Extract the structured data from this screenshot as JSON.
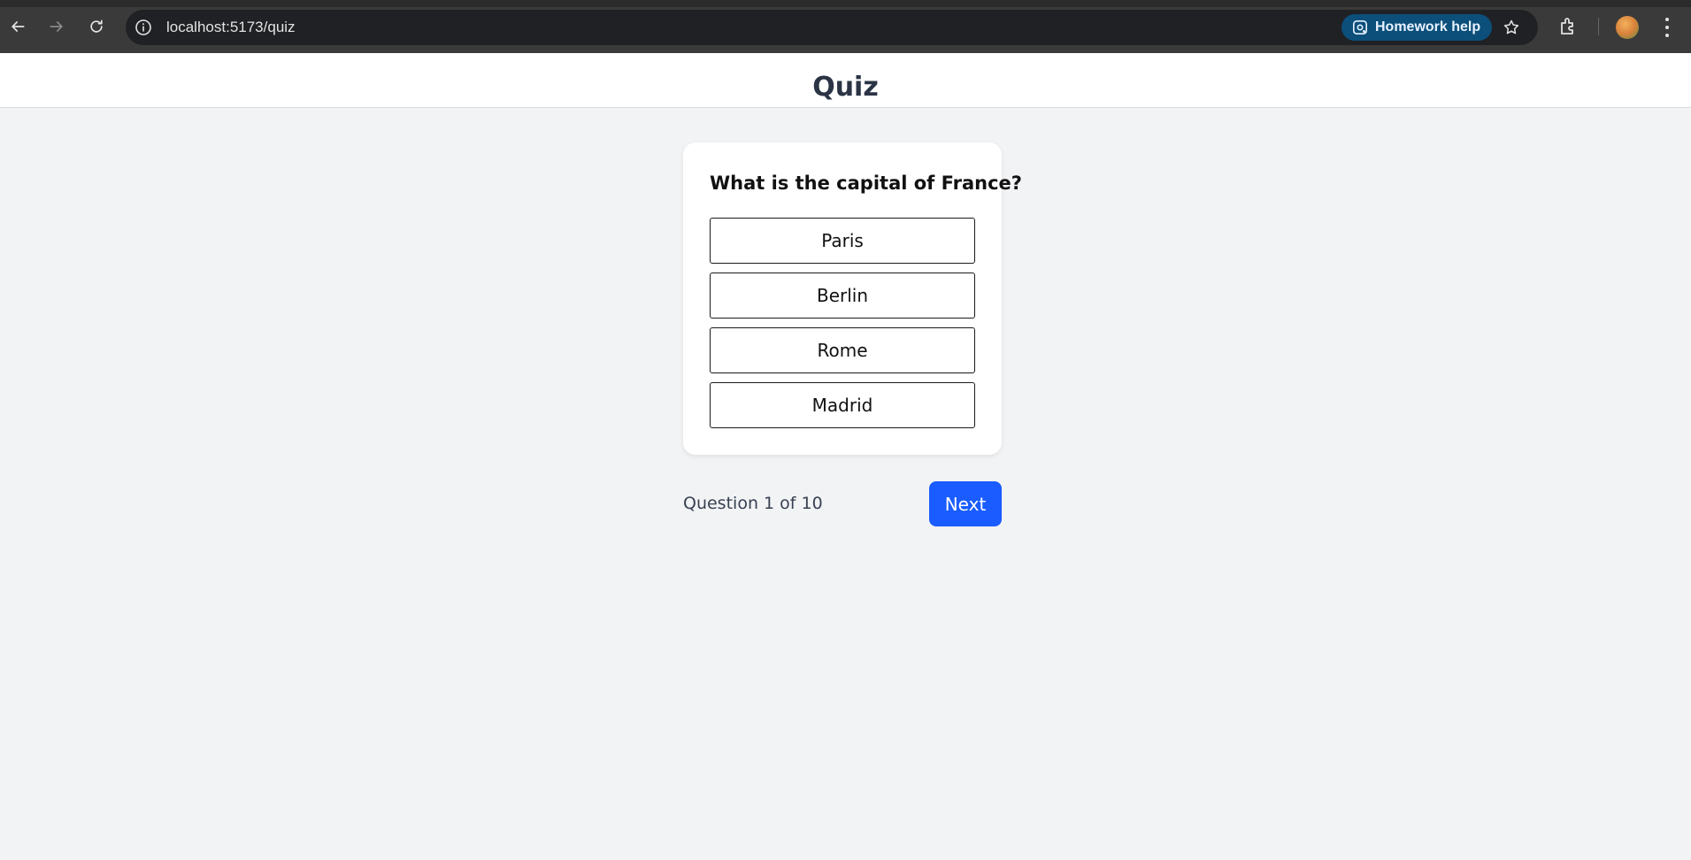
{
  "browser": {
    "url": "localhost:5173/quiz",
    "homework_help_label": "Homework help"
  },
  "header": {
    "title": "Quiz"
  },
  "quiz": {
    "question": "What is the capital of France?",
    "options": [
      {
        "label": "Paris"
      },
      {
        "label": "Berlin"
      },
      {
        "label": "Rome"
      },
      {
        "label": "Madrid"
      }
    ],
    "progress_text": "Question 1 of 10",
    "next_label": "Next"
  },
  "colors": {
    "accent": "#1a5cff",
    "page_background": "#f2f3f5",
    "title_text": "#2b3445"
  }
}
